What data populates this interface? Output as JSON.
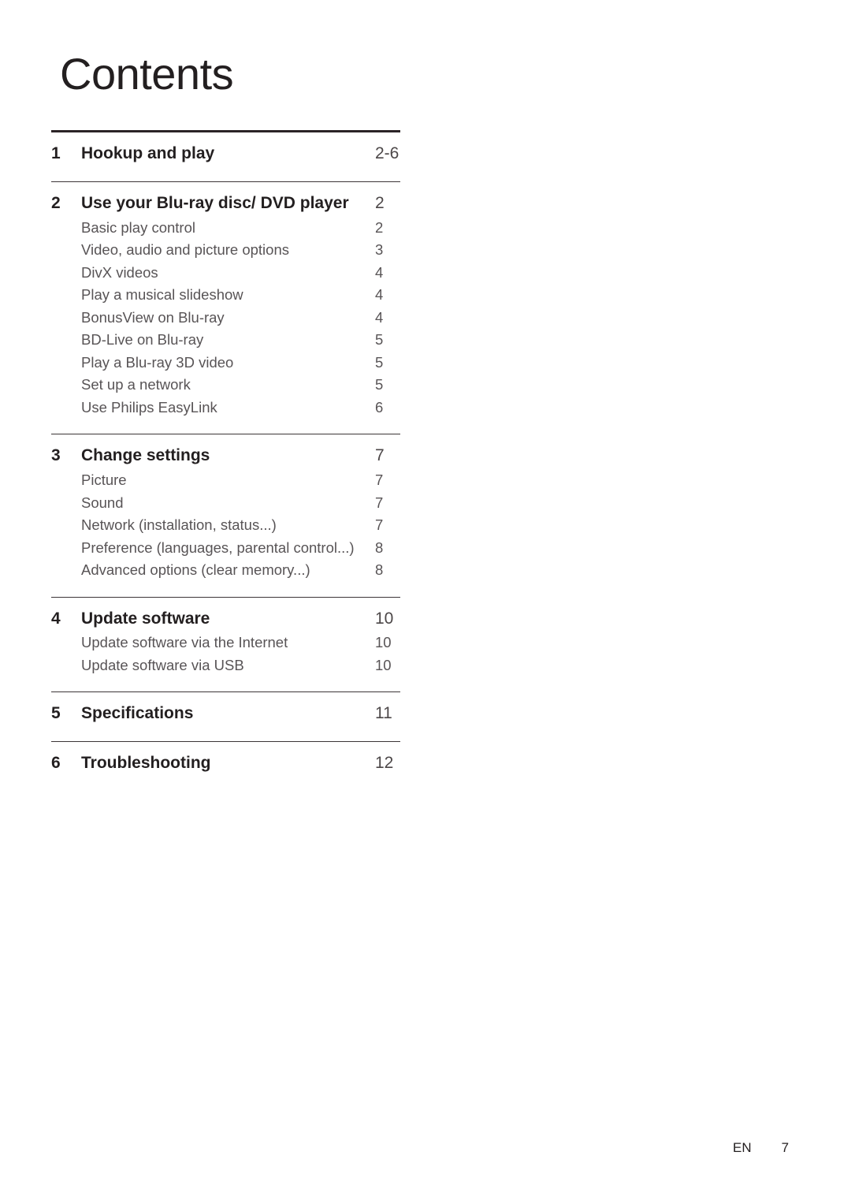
{
  "document": {
    "title": "Contents"
  },
  "toc": {
    "groups": [
      {
        "number": "1",
        "title": "Hookup and play",
        "page": "2-6",
        "subentries": []
      },
      {
        "number": "2",
        "title": "Use your Blu-ray disc/ DVD player",
        "page": "2",
        "subentries": [
          {
            "label": "Basic play control",
            "page": "2"
          },
          {
            "label": "Video, audio and picture options",
            "page": "3"
          },
          {
            "label": "DivX videos",
            "page": "4"
          },
          {
            "label": "Play a musical slideshow",
            "page": "4"
          },
          {
            "label": "BonusView on Blu-ray",
            "page": "4"
          },
          {
            "label": "BD-Live on Blu-ray",
            "page": "5"
          },
          {
            "label": "Play a Blu-ray 3D video",
            "page": "5"
          },
          {
            "label": "Set up a network",
            "page": "5"
          },
          {
            "label": "Use Philips EasyLink",
            "page": "6"
          }
        ]
      },
      {
        "number": "3",
        "title": "Change settings",
        "page": "7",
        "subentries": [
          {
            "label": "Picture",
            "page": "7"
          },
          {
            "label": "Sound",
            "page": "7"
          },
          {
            "label": "Network (installation, status...)",
            "page": "7"
          },
          {
            "label": "Preference (languages, parental control...)",
            "page": "8"
          },
          {
            "label": "Advanced options (clear memory...)",
            "page": "8"
          }
        ]
      },
      {
        "number": "4",
        "title": "Update software",
        "page": "10",
        "subentries": [
          {
            "label": "Update software via the Internet",
            "page": "10"
          },
          {
            "label": "Update software via USB",
            "page": "10"
          }
        ]
      },
      {
        "number": "5",
        "title": "Specifications",
        "page": "11",
        "subentries": []
      },
      {
        "number": "6",
        "title": "Troubleshooting",
        "page": "12",
        "subentries": []
      }
    ]
  },
  "footer": {
    "language": "EN",
    "page_number": "7"
  }
}
